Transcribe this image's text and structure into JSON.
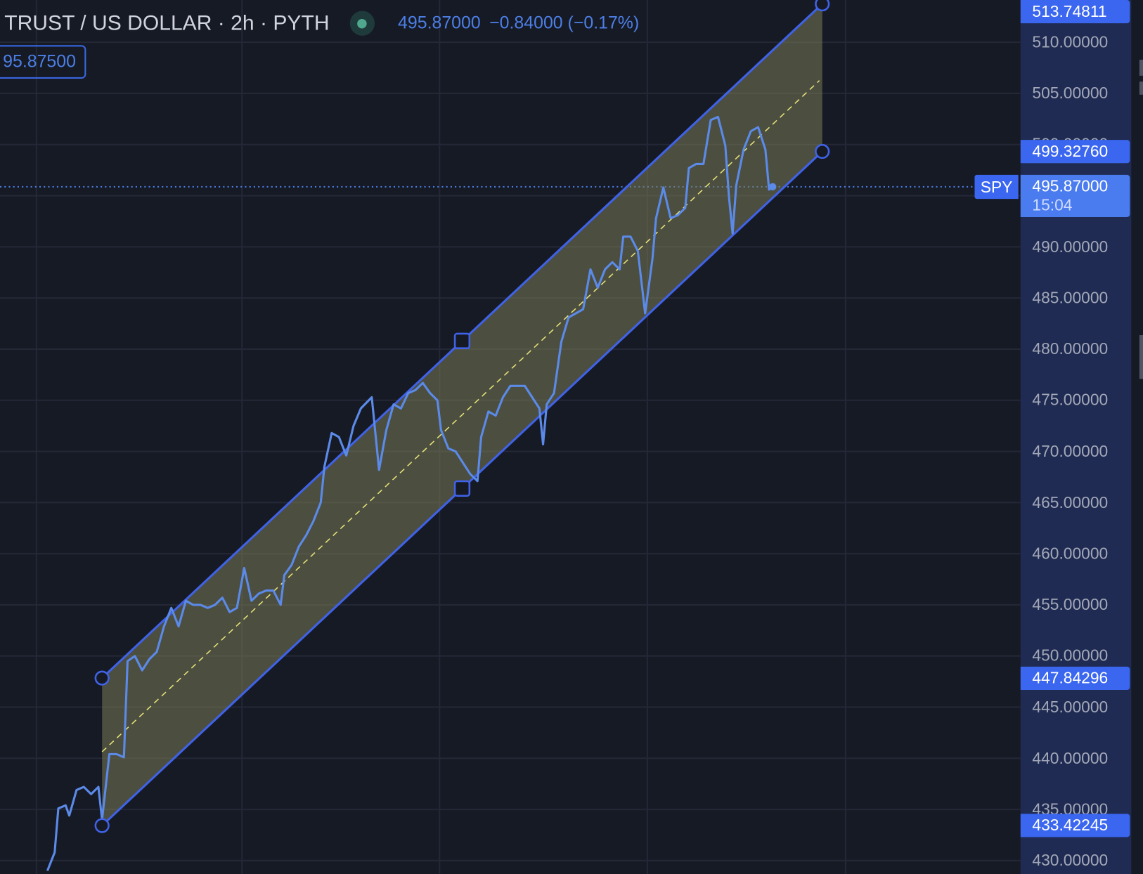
{
  "header": {
    "title": "TRUST / US DOLLAR · 2h · PYTH",
    "last_price": "495.87000",
    "change": "−0.84000 (−0.17%)",
    "market_status_icon": "market-open-dot-icon",
    "order_price": "95.87500"
  },
  "colors": {
    "background": "#161a25",
    "line": "#5b8ae8",
    "channel": "#3f62e6",
    "fill": "#7a7a55",
    "median": "#e6e27a",
    "axis": "#1f2b52"
  },
  "price_axis": {
    "ticks": [
      "510.00000",
      "505.00000",
      "500.00000",
      "490.00000",
      "485.00000",
      "480.00000",
      "475.00000",
      "470.00000",
      "465.00000",
      "460.00000",
      "455.00000",
      "450.00000",
      "445.00000",
      "440.00000",
      "435.00000",
      "430.00000"
    ],
    "tick_values": [
      510,
      505,
      500,
      490,
      485,
      480,
      475,
      470,
      465,
      460,
      455,
      450,
      445,
      440,
      435,
      430
    ],
    "badges": [
      {
        "label": "513.74811",
        "value": 513.74811
      },
      {
        "label": "499.32760",
        "value": 499.3276
      },
      {
        "label": "447.84296",
        "value": 447.84296
      },
      {
        "label": "433.42245",
        "value": 433.42245
      }
    ],
    "current": {
      "symbol": "SPY",
      "price": "495.87000",
      "value": 495.87,
      "countdown": "15:04"
    }
  },
  "chart_data": {
    "type": "line",
    "series_name": "SPY",
    "x_unit": "bar index (2h bars)",
    "ylim": [
      429.5,
      514.5
    ],
    "points": [
      [
        0,
        429.0
      ],
      [
        2,
        430.8
      ],
      [
        3,
        435.1
      ],
      [
        5,
        435.4
      ],
      [
        6,
        434.4
      ],
      [
        8,
        436.9
      ],
      [
        10,
        437.2
      ],
      [
        12,
        436.5
      ],
      [
        14,
        437.2
      ],
      [
        15,
        434.0
      ],
      [
        17,
        440.4
      ],
      [
        19,
        440.4
      ],
      [
        21,
        440.1
      ],
      [
        22,
        449.5
      ],
      [
        24,
        450.0
      ],
      [
        26,
        448.6
      ],
      [
        28,
        449.7
      ],
      [
        30,
        450.4
      ],
      [
        32,
        452.9
      ],
      [
        34,
        454.7
      ],
      [
        36,
        452.9
      ],
      [
        38,
        455.4
      ],
      [
        40,
        455.0
      ],
      [
        42,
        455.0
      ],
      [
        44,
        454.7
      ],
      [
        46,
        455.0
      ],
      [
        48,
        455.7
      ],
      [
        50,
        454.3
      ],
      [
        52,
        454.7
      ],
      [
        54,
        458.6
      ],
      [
        56,
        455.4
      ],
      [
        58,
        456.1
      ],
      [
        60,
        456.4
      ],
      [
        62,
        456.4
      ],
      [
        64,
        455.0
      ],
      [
        65,
        457.9
      ],
      [
        67,
        458.9
      ],
      [
        69,
        460.7
      ],
      [
        71,
        461.8
      ],
      [
        73,
        463.2
      ],
      [
        75,
        465.0
      ],
      [
        76,
        468.5
      ],
      [
        78,
        471.8
      ],
      [
        80,
        471.4
      ],
      [
        82,
        469.6
      ],
      [
        84,
        472.5
      ],
      [
        86,
        474.2
      ],
      [
        89,
        475.3
      ],
      [
        91,
        468.2
      ],
      [
        93,
        472.1
      ],
      [
        95,
        474.6
      ],
      [
        97,
        474.2
      ],
      [
        99,
        475.7
      ],
      [
        101,
        476.0
      ],
      [
        103,
        476.7
      ],
      [
        105,
        475.7
      ],
      [
        107,
        475.0
      ],
      [
        108,
        472.1
      ],
      [
        110,
        470.3
      ],
      [
        112,
        470.0
      ],
      [
        114,
        468.9
      ],
      [
        116,
        467.8
      ],
      [
        118,
        467.1
      ],
      [
        119,
        471.4
      ],
      [
        121,
        473.9
      ],
      [
        123,
        473.5
      ],
      [
        125,
        475.3
      ],
      [
        127,
        476.4
      ],
      [
        129,
        476.4
      ],
      [
        131,
        476.4
      ],
      [
        133,
        475.3
      ],
      [
        135,
        474.2
      ],
      [
        136,
        470.7
      ],
      [
        137,
        474.6
      ],
      [
        139,
        475.7
      ],
      [
        141,
        480.7
      ],
      [
        143,
        483.1
      ],
      [
        145,
        483.5
      ],
      [
        147,
        483.9
      ],
      [
        149,
        487.8
      ],
      [
        151,
        486.0
      ],
      [
        153,
        487.8
      ],
      [
        155,
        488.5
      ],
      [
        157,
        487.8
      ],
      [
        158,
        491.0
      ],
      [
        160,
        491.0
      ],
      [
        162,
        489.6
      ],
      [
        164,
        483.5
      ],
      [
        166,
        488.8
      ],
      [
        167,
        492.8
      ],
      [
        169,
        495.8
      ],
      [
        171,
        492.8
      ],
      [
        173,
        493.1
      ],
      [
        175,
        493.8
      ],
      [
        176,
        497.7
      ],
      [
        178,
        498.1
      ],
      [
        180,
        498.1
      ],
      [
        182,
        502.4
      ],
      [
        184,
        502.7
      ],
      [
        186,
        499.9
      ],
      [
        187,
        494.9
      ],
      [
        188,
        491.3
      ],
      [
        189,
        496.0
      ],
      [
        191,
        499.5
      ],
      [
        193,
        501.3
      ],
      [
        195,
        501.7
      ],
      [
        197,
        499.5
      ],
      [
        198,
        495.6
      ],
      [
        199,
        495.87
      ]
    ],
    "channel": {
      "start_bar": 15,
      "end_bar": 212.6,
      "upper": [
        447.84296,
        513.74811
      ],
      "lower": [
        433.42245,
        499.3276
      ]
    }
  }
}
